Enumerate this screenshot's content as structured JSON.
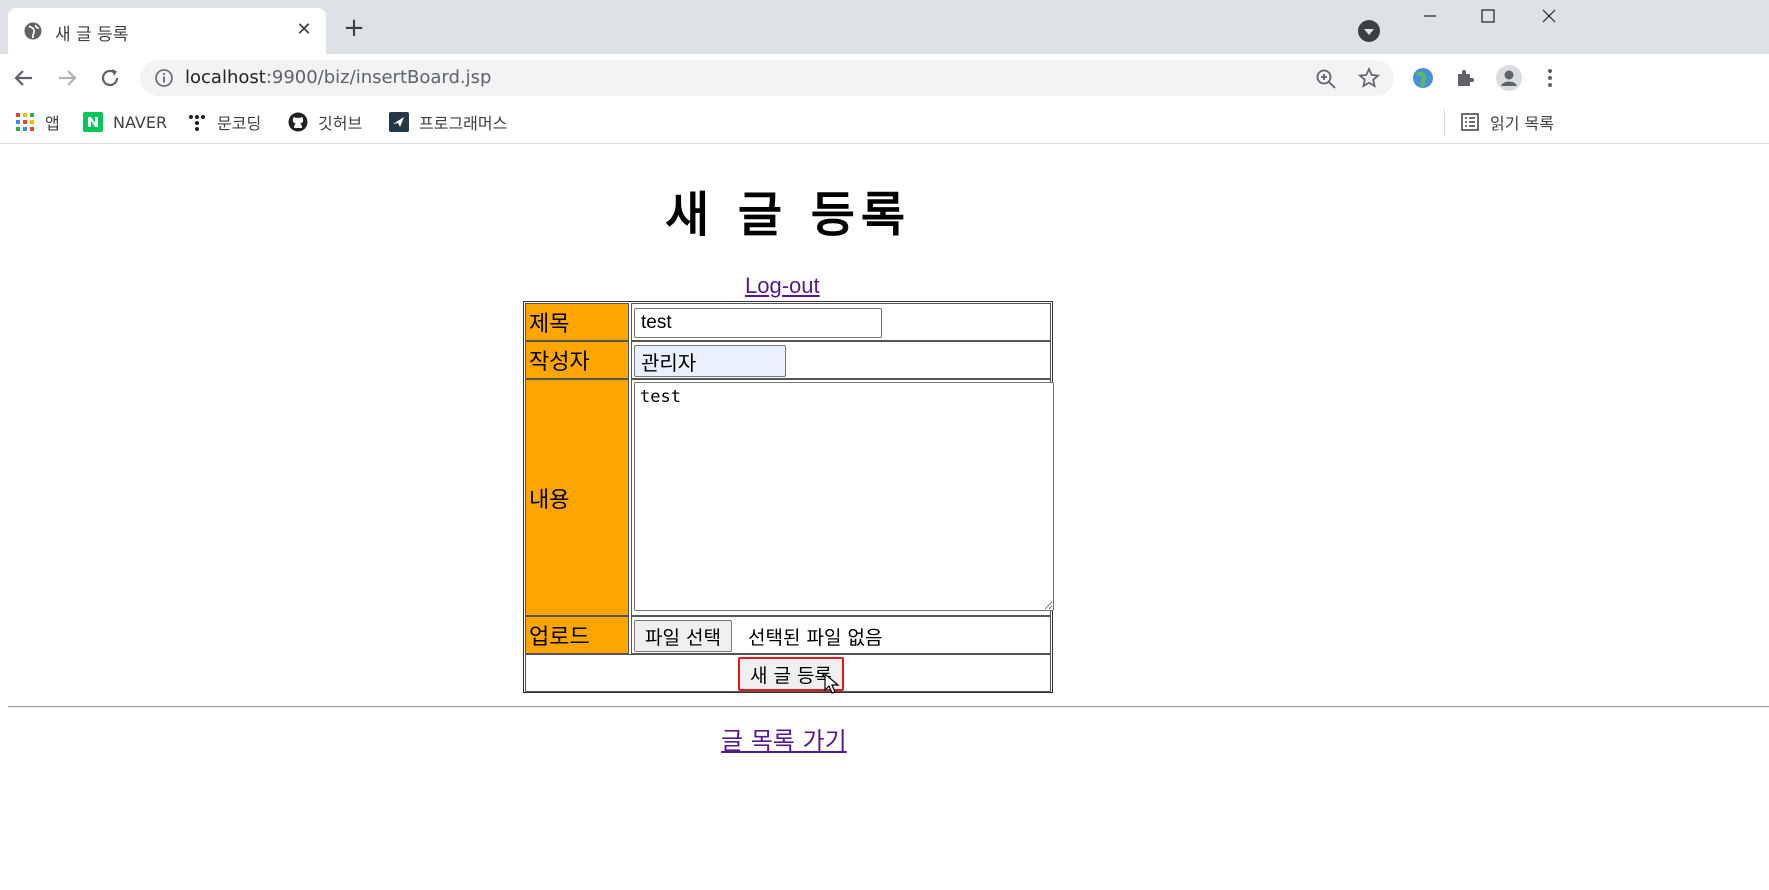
{
  "browser": {
    "tab_title": "새 글 등록",
    "url_host": "localhost",
    "url_path": ":9900/biz/insertBoard.jsp",
    "bookmarks": [
      {
        "label": "앱",
        "icon": "apps-grid-icon"
      },
      {
        "label": "NAVER",
        "icon": "naver-icon"
      },
      {
        "label": "문코딩",
        "icon": "moncoding-icon"
      },
      {
        "label": "깃허브",
        "icon": "github-icon"
      },
      {
        "label": "프로그래머스",
        "icon": "programmers-icon"
      }
    ],
    "reading_list": "읽기 목록"
  },
  "page": {
    "heading": "새 글 등록",
    "logout_link": "Log-out",
    "form": {
      "title_label": "제목",
      "title_value": "test",
      "writer_label": "작성자",
      "writer_value": "관리자",
      "content_label": "내용",
      "content_value": "test",
      "upload_label": "업로드",
      "file_button": "파일 선택",
      "file_status": "선택된 파일 없음",
      "submit_button": "새 글 등록"
    },
    "list_link": "글 목록 가기"
  },
  "colors": {
    "label_bg": "#ffa500",
    "link": "#551a8b",
    "autofill_bg": "#e8f0fe",
    "focus_outline": "#e01b1b"
  }
}
